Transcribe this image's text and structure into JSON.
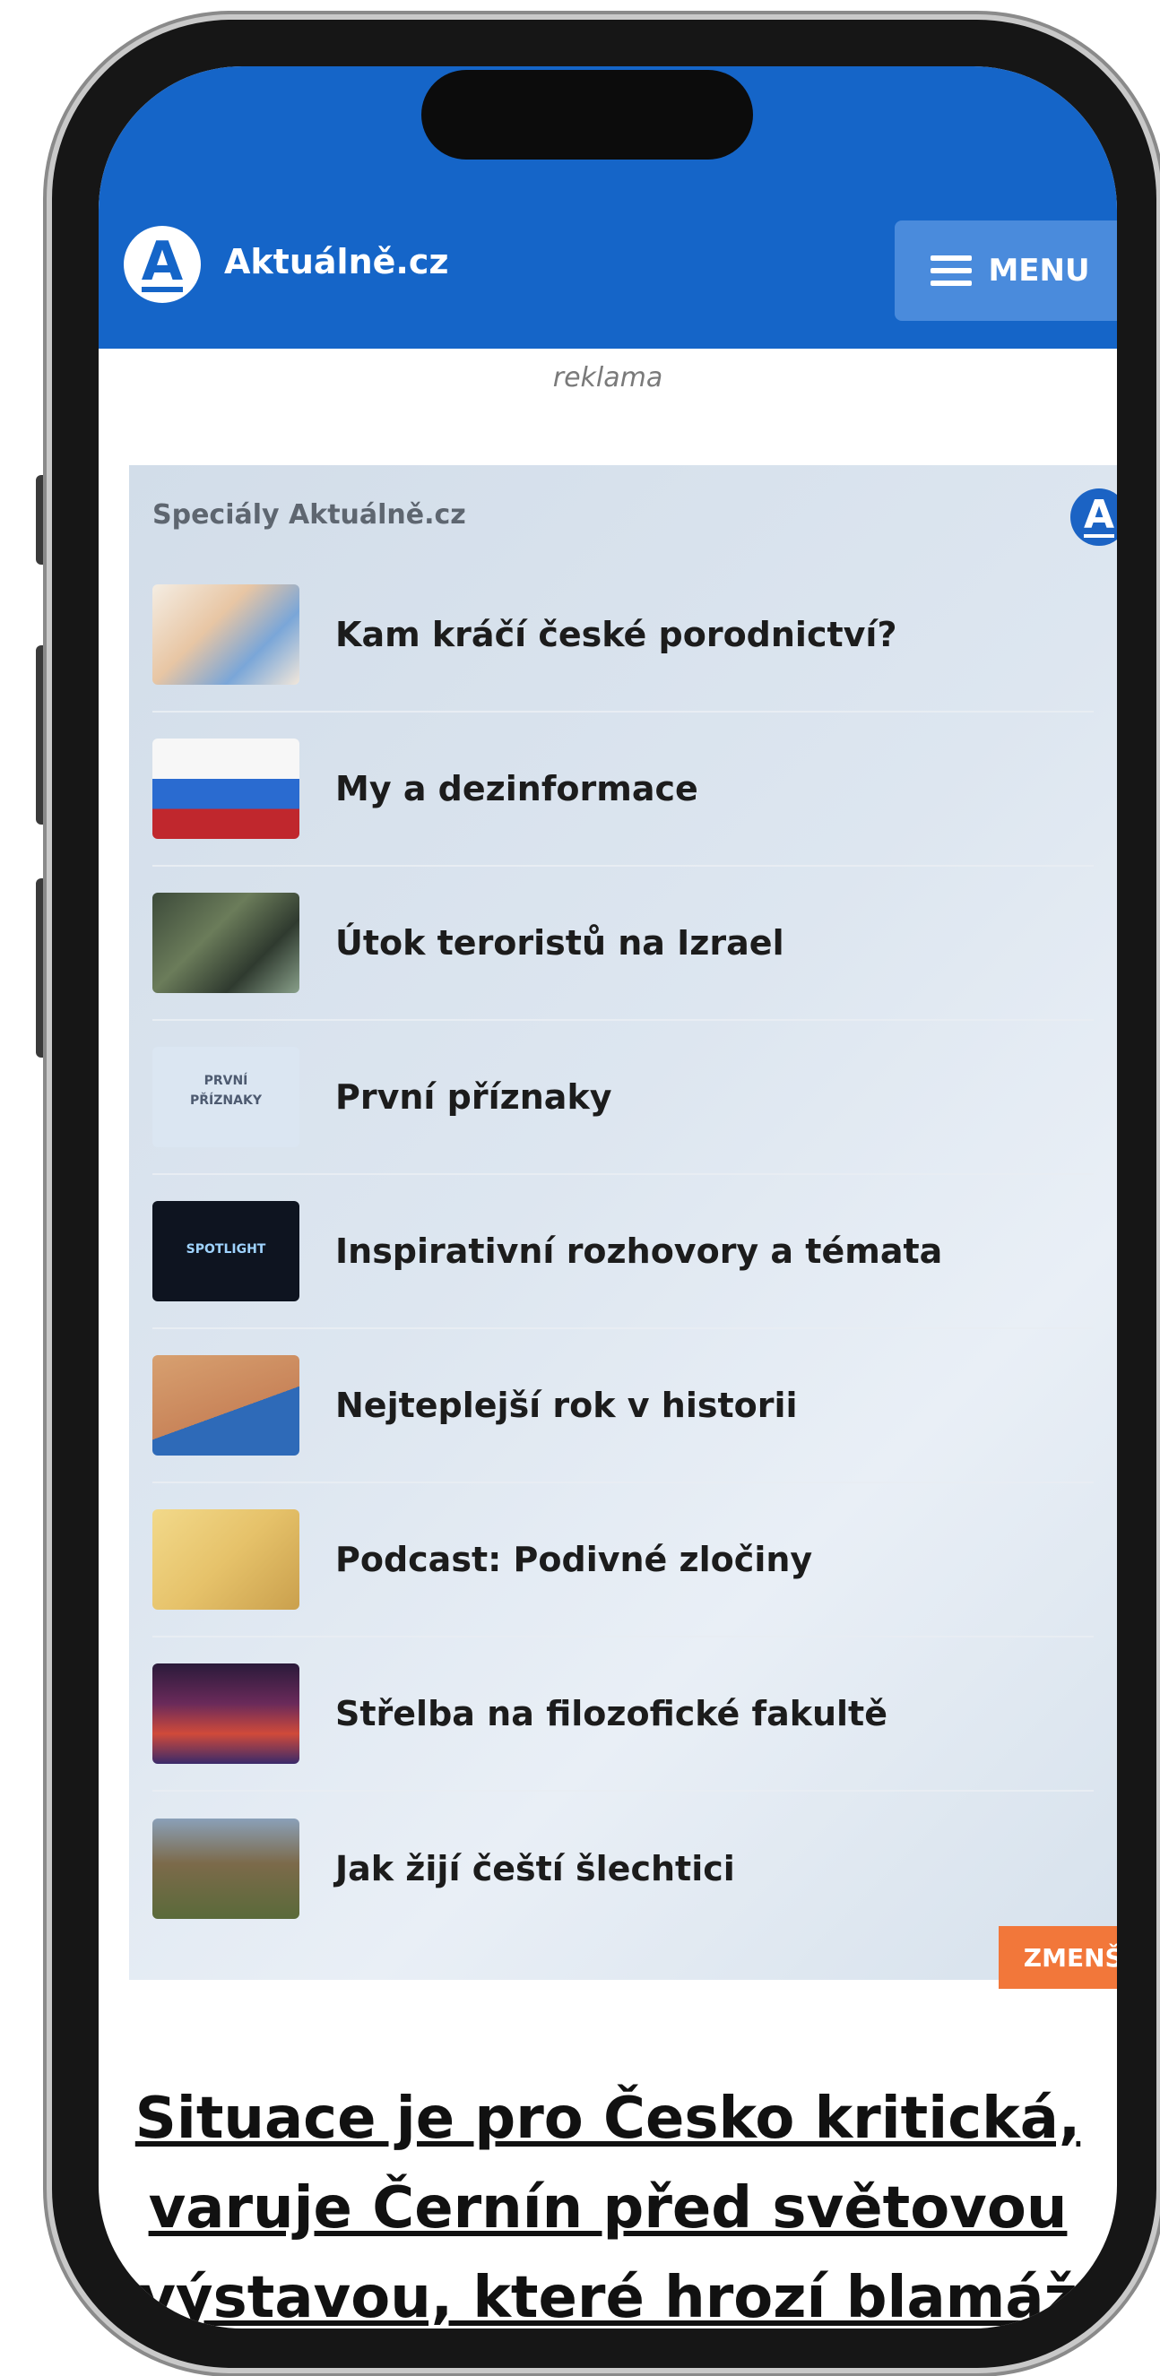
{
  "header": {
    "logo_letter": "A",
    "site_name": "Aktuálně.cz",
    "menu_label": "MENU",
    "brand_color": "#1565c8"
  },
  "ad": {
    "label": "reklama"
  },
  "specials": {
    "title": "Speciály Aktuálně.cz",
    "logo_letter": "A",
    "items": [
      {
        "label": "Kam kráčí české porodnictví?"
      },
      {
        "label": "My a dezinformace"
      },
      {
        "label": "Útok teroristů na Izrael"
      },
      {
        "label": "První příznaky",
        "thumb_text_1": "PRVNÍ",
        "thumb_text_2": "PŘÍZNAKY"
      },
      {
        "label": "Inspirativní rozhovory a témata",
        "thumb_text_1": "SPOTLIGHT"
      },
      {
        "label": "Nejteplejší rok v historii"
      },
      {
        "label": "Podcast: Podivné zločiny"
      },
      {
        "label": "Střelba na filozofické fakultě"
      },
      {
        "label": "Jak žijí čeští šlechtici"
      }
    ],
    "shrink_label": "ZMENŠIT",
    "shrink_color": "#f2773a"
  },
  "article": {
    "headline_line1": "Situace je pro Česko kritická,",
    "headline_line2": "varuje Černín před světovou",
    "headline_line3": "výstavou, které hrozí blamáž"
  }
}
